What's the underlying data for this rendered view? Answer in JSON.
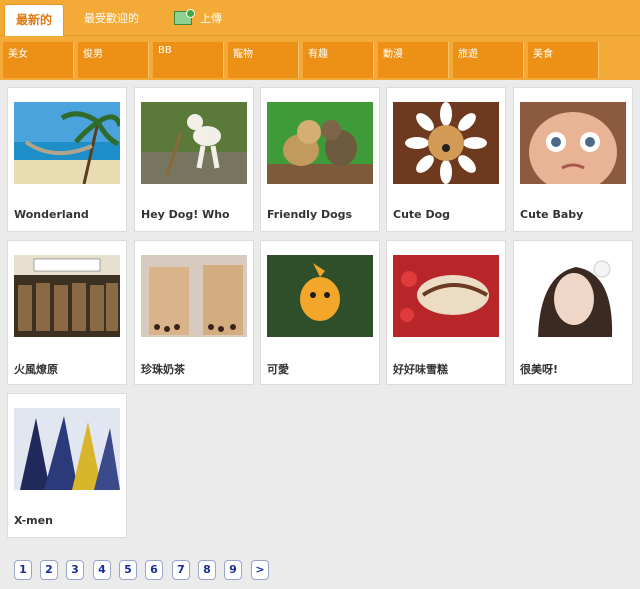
{
  "tabs": {
    "newest": "最新的",
    "popular": "最受歡迎的",
    "upload": "上傳"
  },
  "categories": [
    "美女",
    "俊男",
    "BB",
    "寵物",
    "有趣",
    "動漫",
    "旅遊",
    "美食"
  ],
  "items": [
    {
      "caption": "Wonderland"
    },
    {
      "caption": "Hey Dog! Who"
    },
    {
      "caption": "Friendly Dogs"
    },
    {
      "caption": "Cute Dog"
    },
    {
      "caption": "Cute Baby"
    },
    {
      "caption": "火風燎原"
    },
    {
      "caption": "珍珠奶茶"
    },
    {
      "caption": "可愛"
    },
    {
      "caption": "好好味雪糕"
    },
    {
      "caption": "很美呀!"
    },
    {
      "caption": "X-men"
    }
  ],
  "pagination": [
    "1",
    "2",
    "3",
    "4",
    "5",
    "6",
    "7",
    "8",
    "9",
    ">"
  ]
}
